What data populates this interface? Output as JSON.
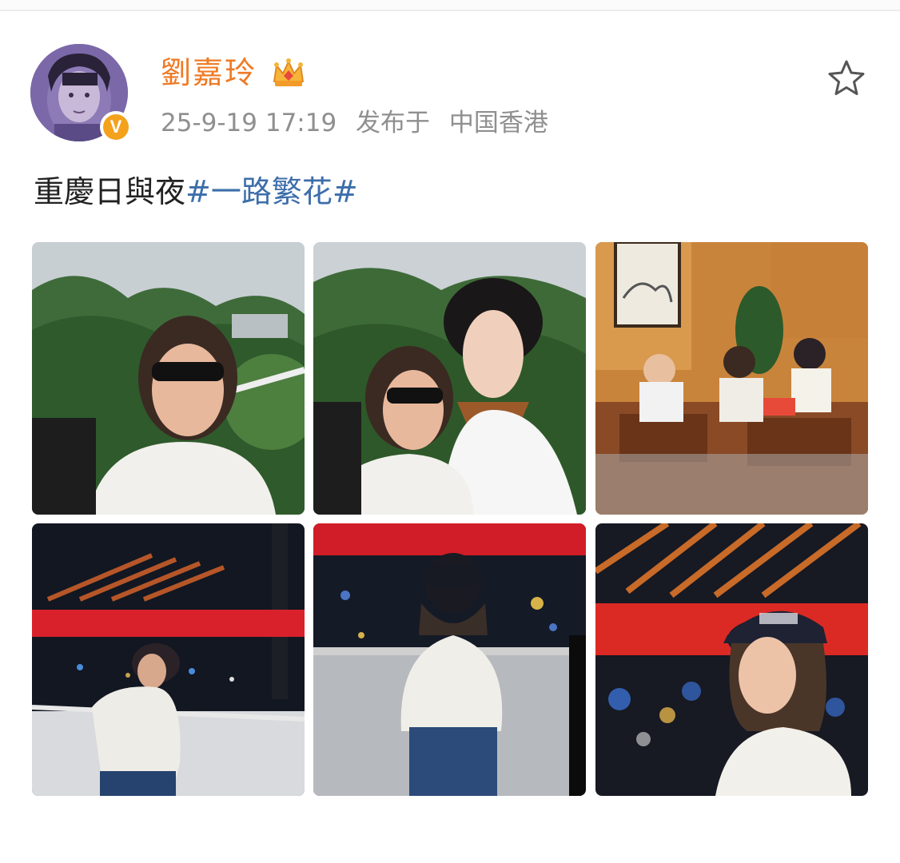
{
  "post": {
    "username": "劉嘉玲",
    "timestamp": "25-9-19 17:19",
    "location_prefix": "发布于",
    "location": "中国香港",
    "text": "重慶日與夜",
    "hashtag": "#一路繁花#",
    "badge": "V",
    "photos": [
      {
        "scene": "mountain-selfie"
      },
      {
        "scene": "mountain-duo-selfie"
      },
      {
        "scene": "group-teahouse"
      },
      {
        "scene": "night-bridge-pose"
      },
      {
        "scene": "night-back-view"
      },
      {
        "scene": "night-cap-portrait"
      }
    ]
  },
  "icons": {
    "crown": "crown-icon",
    "favorite": "star-icon",
    "verified": "verified-badge"
  },
  "colors": {
    "username": "#ef7a24",
    "hashtag": "#3d6eaa",
    "meta": "#8f8f8f",
    "badge": "#f4a21c"
  }
}
